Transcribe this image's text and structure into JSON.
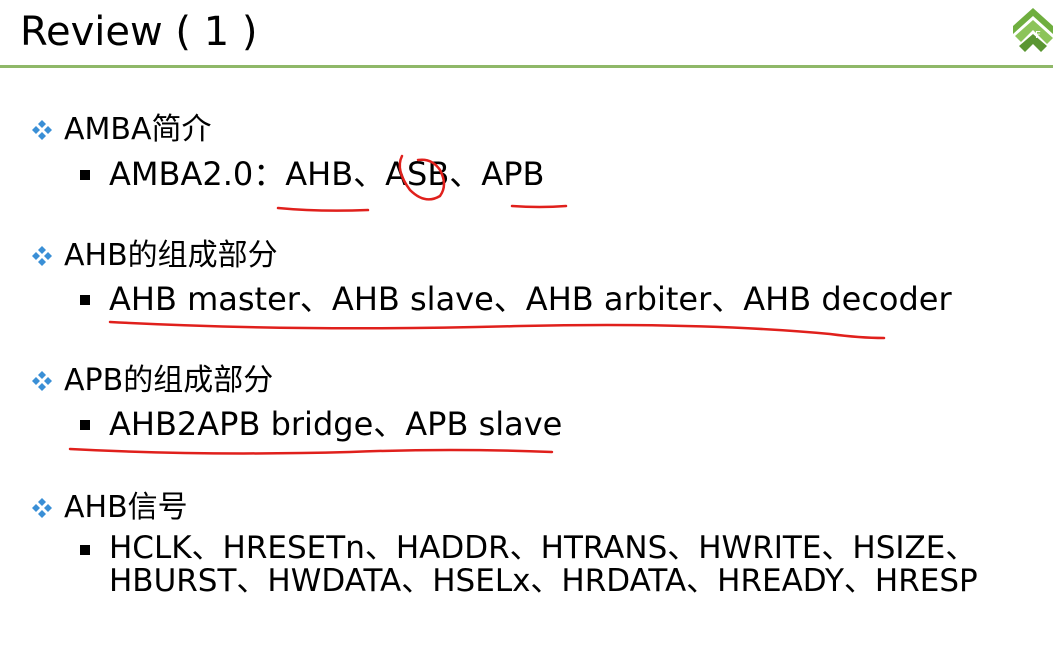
{
  "slide": {
    "title": "Review ( 1 )"
  },
  "sections": [
    {
      "heading": "AMBA简介",
      "items": [
        "AMBA2.0：AHB、ASB、APB"
      ]
    },
    {
      "heading": "AHB的组成部分",
      "items": [
        "AHB master、AHB slave、AHB arbiter、AHB decoder"
      ]
    },
    {
      "heading": "APB的组成部分",
      "items": [
        "AHB2APB bridge、APB slave"
      ]
    },
    {
      "heading": "AHB信号",
      "items": [
        "HCLK、HRESETn、HADDR、HTRANS、HWRITE、HSIZE、HBURST、HWDATA、HSELx、HRDATA、HREADY、HRESP"
      ]
    }
  ],
  "colors": {
    "title_rule": "#8fb868",
    "bullet_diamond": "#3a8fd6",
    "annotation_ink": "#e0201c",
    "logo": "#6fae3f"
  },
  "icons": {
    "logo": "green-geometric-logo-icon",
    "bullet_l1": "four-diamond-bullet-icon",
    "bullet_l2": "square-bullet-icon"
  }
}
